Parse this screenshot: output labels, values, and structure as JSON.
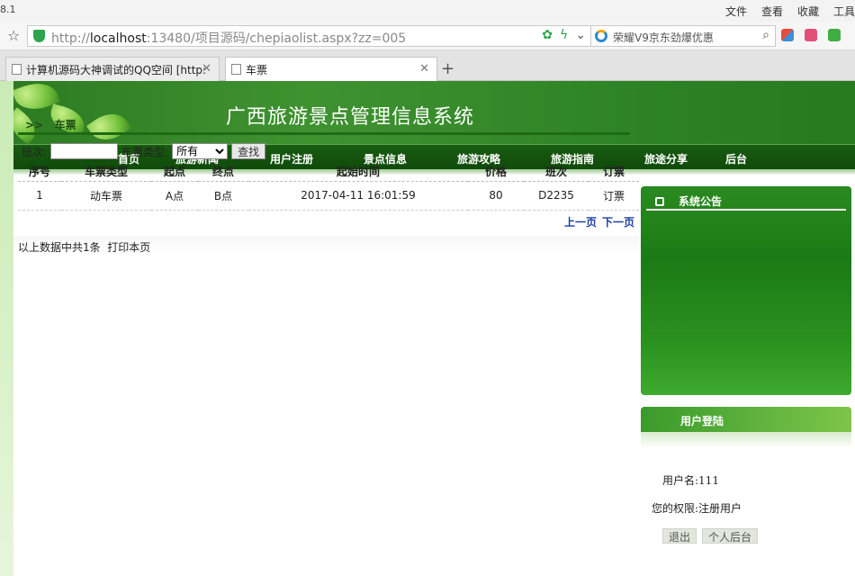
{
  "browser": {
    "version_text": "8.1",
    "menu": [
      "文件",
      "查看",
      "收藏",
      "工具"
    ],
    "url_prefix": "http://",
    "url_host": "localhost",
    "url_rest": ":13480/项目源码/chepiaolist.aspx?zz=005",
    "search_text": "荣耀V9京东劲爆优惠",
    "tabs": [
      {
        "title": "计算机源码大神调试的QQ空间 [http:"
      },
      {
        "title": "车票"
      }
    ]
  },
  "site": {
    "title": "广西旅游景点管理信息系统",
    "nav": [
      "首页",
      "旅游新闻",
      "用户注册",
      "景点信息",
      "旅游攻略",
      "旅游指南",
      "旅途分享",
      "后台"
    ]
  },
  "content": {
    "crumb_arrow": ">>",
    "crumb_label": "车票",
    "search": {
      "banci_label": "班次:",
      "banci_value": "",
      "type_label": "车票类型:",
      "type_selected": "所有",
      "button": "查找"
    },
    "table": {
      "headers": [
        "序号",
        "车票类型",
        "起点",
        "终点",
        "起始时间",
        "价格",
        "班次",
        "订票"
      ],
      "rows": [
        [
          "1",
          "动车票",
          "A点",
          "B点",
          "2017-04-11 16:01:59",
          "80",
          "D2235",
          "订票"
        ]
      ]
    },
    "pager": {
      "prev": "上一页",
      "next": "下一页"
    },
    "footer_count": "以上数据中共1条",
    "footer_print": "打印本页"
  },
  "sidebar": {
    "notice_title": "系统公告",
    "login_title": "用户登陆",
    "username_line": "用户名:111",
    "role_line": "您的权限:注册用户",
    "logout": "退出",
    "personal": "个人后台"
  },
  "colors": {
    "banner_green": "#2d7b22",
    "nav_green": "#0f4a0a",
    "pager_blue": "#1a3fa3"
  }
}
